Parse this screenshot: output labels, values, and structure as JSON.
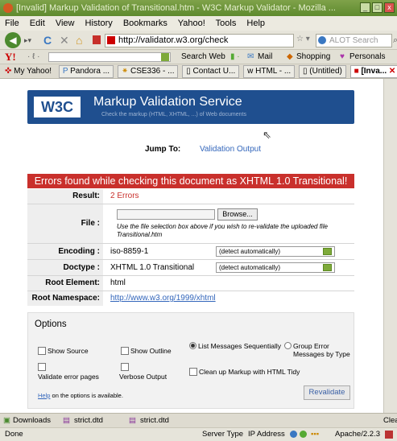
{
  "window": {
    "title": "[Invalid] Markup Validation of Transitional.htm - W3C Markup Validator - Mozilla ...",
    "min_label": "_",
    "max_label": "□",
    "close_label": "x"
  },
  "menu": [
    "File",
    "Edit",
    "View",
    "History",
    "Bookmarks",
    "Yahoo!",
    "Tools",
    "Help"
  ],
  "nav": {
    "url": "http://validator.w3.org/check",
    "search_placeholder": "ALOT Search",
    "reload_glyph": "C",
    "stop_glyph": "✕",
    "home_glyph": "⌂"
  },
  "yahoo_bar": {
    "logo": "Y!",
    "search_web": "Search Web",
    "mail": "Mail",
    "shopping": "Shopping",
    "personals": "Personals"
  },
  "bookmarks": [
    "My Yahoo!",
    "Pandora ...",
    "CSE336 - ...",
    "Contact U...",
    "HTML - ...",
    "(Untitled)",
    "[Inva..."
  ],
  "validator": {
    "logo": "W3C",
    "service_title": "Markup Validation Service",
    "service_subtitle": "Check the markup (HTML, XHTML, ...) of Web documents",
    "jump_label": "Jump To:",
    "jump_link": "Validation Output",
    "error_banner": "Errors found while checking this document as XHTML 1.0 Transitional!",
    "result_label": "Result:",
    "result_value": "2 Errors",
    "file_label": "File :",
    "browse_label": "Browse...",
    "file_note": "Use the file selection box above if you wish to re-validate the uploaded file Transitional.htm",
    "encoding_label": "Encoding :",
    "encoding_value": "iso-8859-1",
    "encoding_select": "(detect automatically)",
    "doctype_label": "Doctype :",
    "doctype_value": "XHTML 1.0 Transitional",
    "doctype_select": "(detect automatically)",
    "root_element_label": "Root Element:",
    "root_element_value": "html",
    "root_namespace_label": "Root Namespace:",
    "root_namespace_value": "http://www.w3.org/1999/xhtml"
  },
  "options": {
    "title": "Options",
    "show_source": "Show Source",
    "show_outline": "Show Outline",
    "list_sequential": "List Messages Sequentially",
    "group_by_type": "Group Error Messages by Type",
    "validate_error_pages": "Validate error pages",
    "verbose_output": "Verbose Output",
    "cleanup_tidy": "Clean up Markup with HTML Tidy",
    "help_link": "Help",
    "help_text": "on the options is available.",
    "revalidate": "Revalidate"
  },
  "downloads": {
    "label": "Downloads",
    "file1": "strict.dtd",
    "file2": "strict.dtd",
    "clear": "Clea"
  },
  "status": {
    "done": "Done",
    "server_type": "Server Type",
    "ip_address": "IP Address",
    "server": "Apache/2.2.3"
  },
  "colors": {
    "titlebar": "#5e8a2e",
    "banner": "#1f4f8f",
    "error": "#c9302c",
    "link": "#3366bb"
  }
}
